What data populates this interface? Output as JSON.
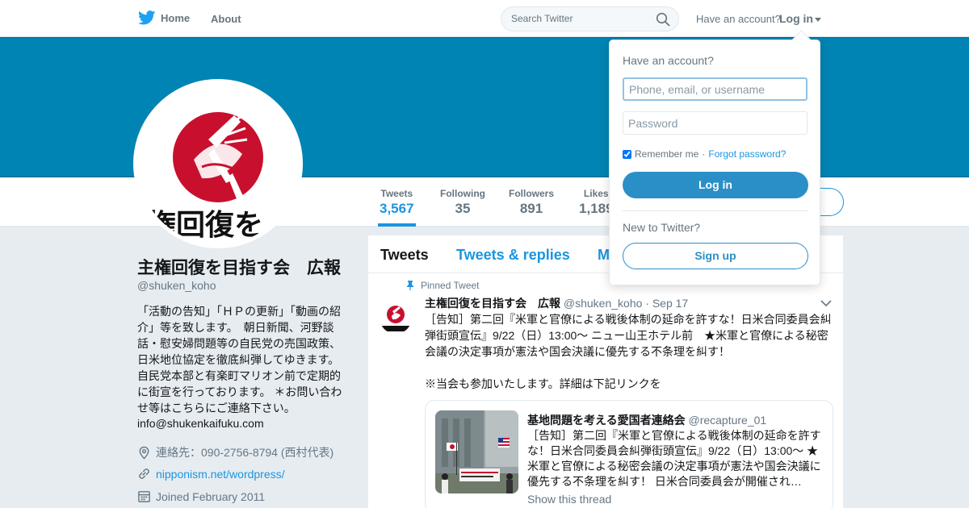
{
  "nav": {
    "home_label": "Home",
    "about_label": "About",
    "search_placeholder": "Search Twitter",
    "have_account": "Have an account?",
    "login_label": "Log in"
  },
  "stats": [
    {
      "label": "Tweets",
      "value": "3,567"
    },
    {
      "label": "Following",
      "value": "35"
    },
    {
      "label": "Followers",
      "value": "891"
    },
    {
      "label": "Likes",
      "value": "1,189"
    }
  ],
  "profile": {
    "name": "主権回復を目指す会　広報",
    "handle": "@shuken_koho",
    "bio": "「活動の告知」「ＨＰの更新」「動画の紹介」等を致します。　朝日新聞、河野談話・慰安婦問題等の自民党の売国政策、日米地位協定を徹底糾弾してゆきます。　自民党本部と有楽町マリオン前で定期的に街宣を行っております。 ＊お問い合わせ等はこちらにご連絡下さい。",
    "email": "info@shukenkaifuku.com",
    "location": "連絡先：090-2756-8794 (西村代表)",
    "website": "nipponism.net/wordpress/",
    "joined": "Joined February 2011",
    "avatar_text": "権回復を"
  },
  "tabs": [
    "Tweets",
    "Tweets & replies",
    "M"
  ],
  "tweet": {
    "pinned_label": "Pinned Tweet",
    "author_name": "主権回復を目指す会　広報",
    "author_handle": "@shuken_koho",
    "date": "· Sep 17",
    "text": "［告知］第二回『米軍と官僚による戦後体制の延命を許すな！日米合同委員会糾弾街頭宣伝』9/22（日）13:00～ ニュー山王ホテル前　★米軍と官僚による秘密会議の決定事項が憲法や国会決議に優先する不条理を糾す！",
    "text2": "※当会も参加いたします。詳細は下記リンクを",
    "quote": {
      "author_name": "基地問題を考える愛国者連絡会",
      "author_handle": "@recapture_01",
      "text": "［告知］第二回『米軍と官僚による戦後体制の延命を許すな！日米合同委員会糾弾街頭宣伝』9/22（日）13:00～ ★米軍と官僚による秘密会議の決定事項が憲法や国会決議に優先する不条理を糾す！ 日米合同委員会が開催され…",
      "show_thread": "Show this thread"
    }
  },
  "login_dropdown": {
    "title": "Have an account?",
    "username_placeholder": "Phone, email, or username",
    "password_placeholder": "Password",
    "remember_label": "Remember me",
    "separator": "·",
    "forgot_label": "Forgot password?",
    "login_button": "Log in",
    "new_label": "New to Twitter?",
    "signup_button": "Sign up"
  },
  "colors": {
    "brand": "#1b95e0",
    "banner": "#0084b4",
    "twitter_bird": "#1da1f2"
  }
}
